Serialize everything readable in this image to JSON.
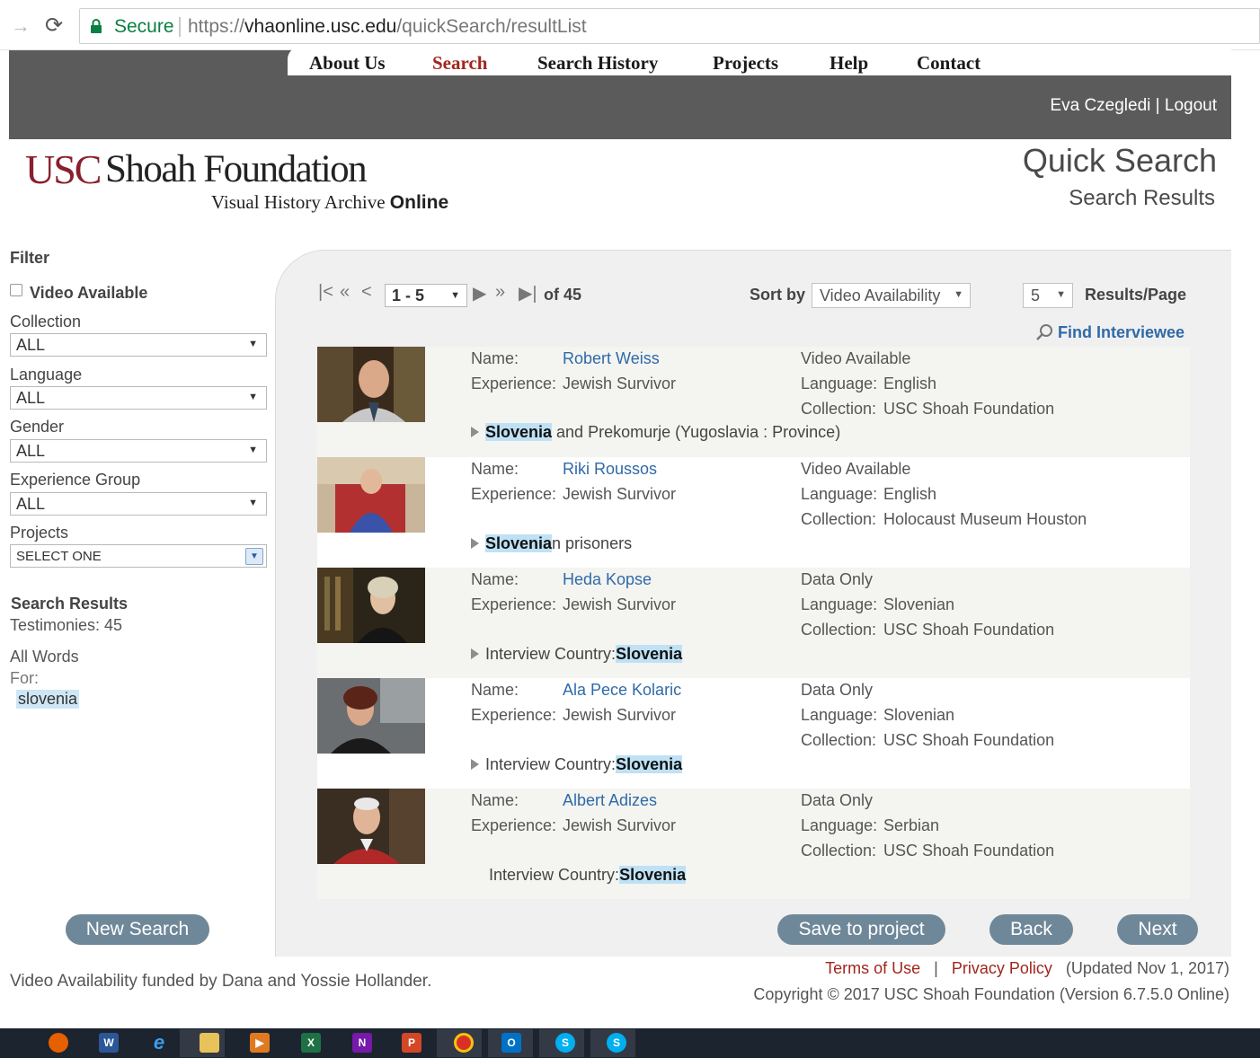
{
  "browser": {
    "secure_label": "Secure",
    "url_scheme": "https://",
    "url_host": "vhaonline.usc.edu",
    "url_path": "/quickSearch/resultList"
  },
  "nav": {
    "items": [
      "About Us",
      "Search",
      "Search History",
      "Projects",
      "Help",
      "Contact"
    ],
    "active": "Search",
    "active_color": "#a0261d",
    "user_name": "Eva Czegledi",
    "separator": "|",
    "logout": "Logout"
  },
  "logo": {
    "usc": "USC",
    "shoah": "Shoah Foundation",
    "sub_serif": "Visual History Archive",
    "sub_bold": "Online"
  },
  "page": {
    "title": "Quick Search",
    "subtitle": "Search Results"
  },
  "filter": {
    "heading": "Filter",
    "video_available_label": "Video Available",
    "video_available_checked": false,
    "collection_label": "Collection",
    "collection_value": "ALL",
    "language_label": "Language",
    "language_value": "ALL",
    "gender_label": "Gender",
    "gender_value": "ALL",
    "experience_label": "Experience Group",
    "experience_value": "ALL",
    "projects_label": "Projects",
    "projects_value": "SELECT ONE"
  },
  "summary": {
    "heading": "Search Results",
    "testimonies": "Testimonies: 45",
    "all_words": "All Words",
    "for": "For:",
    "term": "slovenia"
  },
  "pager": {
    "range": "1 - 5",
    "of": "of 45",
    "sort_label": "Sort by",
    "sort_value": "Video Availability",
    "per_page_value": "5",
    "per_page_label": "Results/Page",
    "find_interviewee": "Find Interviewee"
  },
  "labels": {
    "name": "Name:",
    "experience": "Experience:",
    "language": "Language:",
    "collection": "Collection:"
  },
  "results": [
    {
      "name": "Robert Weiss",
      "experience": "Jewish Survivor",
      "availability": "Video Available",
      "language": "English",
      "collection": "USC Shoah Foundation",
      "snippet_pre": "",
      "snippet_hl": "Slovenia",
      "snippet_post": " and Prekomurje (Yugoslavia : Province)",
      "has_arrow": true
    },
    {
      "name": "Riki Roussos",
      "experience": "Jewish Survivor",
      "availability": "Video Available",
      "language": "English",
      "collection": "Holocaust Museum Houston",
      "snippet_pre": "",
      "snippet_hl": "Slovenia",
      "snippet_post": "n prisoners",
      "has_arrow": true
    },
    {
      "name": "Heda Kopse",
      "experience": "Jewish Survivor",
      "availability": "Data Only",
      "language": "Slovenian",
      "collection": "USC Shoah Foundation",
      "snippet_pre": "Interview Country:",
      "snippet_hl": "Slovenia",
      "snippet_post": "",
      "has_arrow": true
    },
    {
      "name": "Ala Pece Kolaric",
      "experience": "Jewish Survivor",
      "availability": "Data Only",
      "language": "Slovenian",
      "collection": "USC Shoah Foundation",
      "snippet_pre": "Interview Country:",
      "snippet_hl": "Slovenia",
      "snippet_post": "",
      "has_arrow": true
    },
    {
      "name": "Albert Adizes",
      "experience": "Jewish Survivor",
      "availability": "Data Only",
      "language": "Serbian",
      "collection": "USC Shoah Foundation",
      "snippet_pre": "Interview Country:",
      "snippet_hl": "Slovenia",
      "snippet_post": "",
      "has_arrow": false
    }
  ],
  "buttons": {
    "new_search": "New Search",
    "save_to_project": "Save to project",
    "back": "Back",
    "next": "Next"
  },
  "footer": {
    "funding": "Video Availability funded by Dana and Yossie Hollander.",
    "terms": "Terms of Use",
    "separator": "|",
    "privacy": "Privacy Policy",
    "updated": "(Updated Nov 1, 2017)",
    "copyright": "Copyright © 2017 USC Shoah Foundation (Version 6.7.5.0 Online)"
  },
  "taskbar": {
    "icons": [
      "firefox-icon",
      "word-icon",
      "internet-explorer-icon",
      "file-explorer-icon",
      "media-player-icon",
      "excel-icon",
      "onenote-icon",
      "powerpoint-icon",
      "chrome-icon",
      "outlook-icon",
      "skype-icon",
      "skype-business-icon"
    ]
  }
}
